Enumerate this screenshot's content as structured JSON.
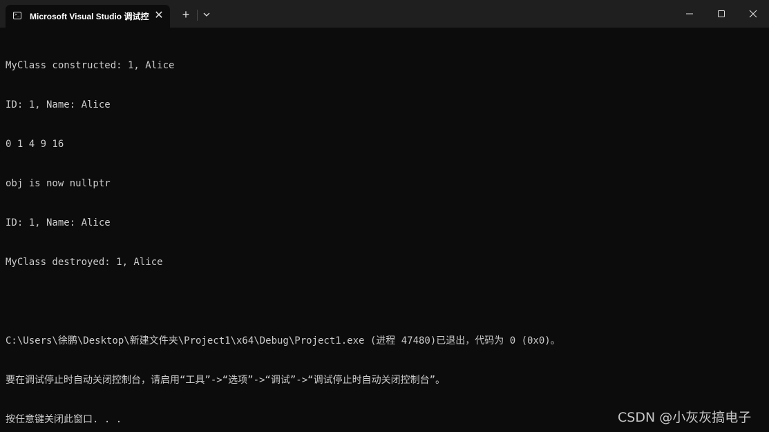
{
  "window": {
    "tab_title": "Microsoft Visual Studio 调试控",
    "tab_icon": "terminal-icon",
    "close_tab_glyph": "✕",
    "new_tab_glyph": "+",
    "colors": {
      "titlebar": "#1f1f1f",
      "terminal_bg": "#0c0c0c",
      "terminal_text": "#cccccc"
    }
  },
  "terminal": {
    "lines": [
      "MyClass constructed: 1, Alice",
      "ID: 1, Name: Alice",
      "0 1 4 9 16",
      "obj is now nullptr",
      "ID: 1, Name: Alice",
      "MyClass destroyed: 1, Alice",
      "",
      "C:\\Users\\徐鹏\\Desktop\\新建文件夹\\Project1\\x64\\Debug\\Project1.exe (进程 47480)已退出，代码为 0 (0x0)。",
      "要在调试停止时自动关闭控制台，请启用“工具”->“选项”->“调试”->“调试停止时自动关闭控制台”。",
      "按任意键关闭此窗口. . ."
    ]
  },
  "watermark": {
    "text": "CSDN @小灰灰搞电子"
  }
}
